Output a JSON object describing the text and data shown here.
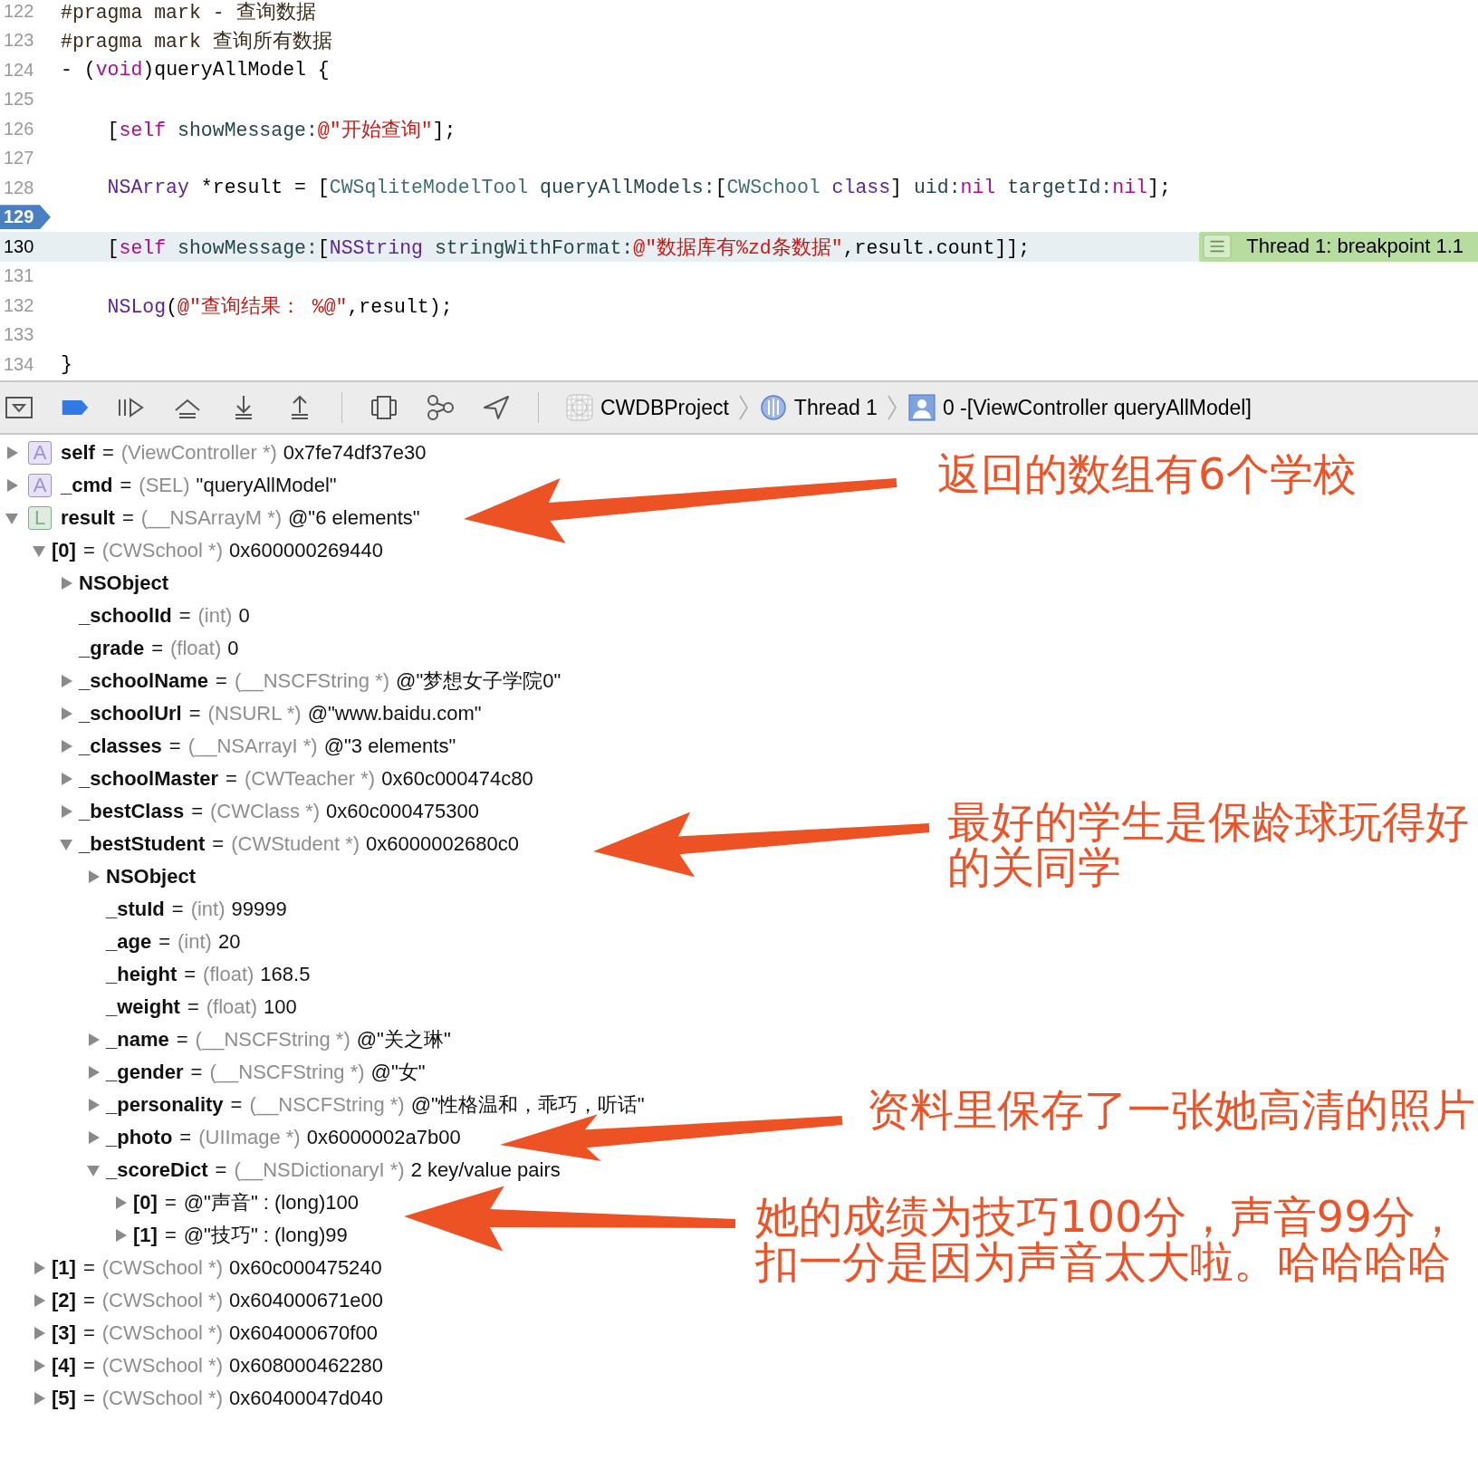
{
  "editor": {
    "lines": [
      {
        "number": "122",
        "breakpoint": false,
        "current": false,
        "tokens": [
          {
            "kind": "pre",
            "text": "#pragma mark - 查询数据"
          }
        ]
      },
      {
        "number": "123",
        "breakpoint": false,
        "current": false,
        "tokens": [
          {
            "kind": "pre",
            "text": "#pragma mark 查询所有数据"
          }
        ]
      },
      {
        "number": "124",
        "breakpoint": false,
        "current": false,
        "tokens": [
          {
            "kind": "plain",
            "text": "- ("
          },
          {
            "kind": "kw",
            "text": "void"
          },
          {
            "kind": "plain",
            "text": ")queryAllModel {"
          }
        ]
      },
      {
        "number": "125",
        "breakpoint": false,
        "current": false
      },
      {
        "number": "126",
        "breakpoint": false,
        "current": false,
        "tokens": [
          {
            "kind": "plain",
            "text": "    ["
          },
          {
            "kind": "kw",
            "text": "self "
          },
          {
            "kind": "meth",
            "text": "showMessage:"
          },
          {
            "kind": "str",
            "text": "@\"开始查询\""
          },
          {
            "kind": "plain",
            "text": "];"
          }
        ]
      },
      {
        "number": "127",
        "breakpoint": false,
        "current": false
      },
      {
        "number": "128",
        "breakpoint": false,
        "current": false,
        "tokens": [
          {
            "kind": "cls",
            "text": "    NSArray"
          },
          {
            "kind": "plain",
            "text": " *result = ["
          },
          {
            "kind": "proj",
            "text": "CWSqliteModelTool "
          },
          {
            "kind": "meth",
            "text": "queryAllModels:"
          },
          {
            "kind": "plain",
            "text": "["
          },
          {
            "kind": "proj",
            "text": "CWSchool "
          },
          {
            "kind": "cls",
            "text": "class"
          },
          {
            "kind": "plain",
            "text": "] "
          },
          {
            "kind": "meth",
            "text": "uid:"
          },
          {
            "kind": "kw",
            "text": "nil "
          },
          {
            "kind": "meth",
            "text": "targetId:"
          },
          {
            "kind": "kw",
            "text": "nil"
          },
          {
            "kind": "plain",
            "text": "];"
          }
        ]
      },
      {
        "number": "129",
        "breakpoint": true,
        "current": false
      },
      {
        "number": "130",
        "breakpoint": false,
        "current": true,
        "badge": "Thread 1: breakpoint 1.1",
        "tokens": [
          {
            "kind": "plain",
            "text": "    ["
          },
          {
            "kind": "kw",
            "text": "self "
          },
          {
            "kind": "meth",
            "text": "showMessage:"
          },
          {
            "kind": "plain",
            "text": "["
          },
          {
            "kind": "cls",
            "text": "NSString "
          },
          {
            "kind": "meth",
            "text": "stringWithFormat:"
          },
          {
            "kind": "str",
            "text": "@\"数据库有%zd条数据\""
          },
          {
            "kind": "plain",
            "text": ",result.count]];"
          }
        ]
      },
      {
        "number": "131",
        "breakpoint": false,
        "current": false
      },
      {
        "number": "132",
        "breakpoint": false,
        "current": false,
        "tokens": [
          {
            "kind": "cls",
            "text": "    NSLog"
          },
          {
            "kind": "plain",
            "text": "("
          },
          {
            "kind": "str",
            "text": "@\"查询结果： %@\""
          },
          {
            "kind": "plain",
            "text": ",result);"
          }
        ]
      },
      {
        "number": "133",
        "breakpoint": false,
        "current": false
      },
      {
        "number": "134",
        "breakpoint": false,
        "current": false,
        "tokens": [
          {
            "kind": "plain",
            "text": "}"
          }
        ]
      }
    ]
  },
  "debug_bar": {
    "breadcrumbs": [
      {
        "kind": "app",
        "text": "CWDBProject"
      },
      {
        "kind": "thread",
        "text": "Thread 1"
      },
      {
        "kind": "frame",
        "text": "0 -[ViewController queryAllModel]"
      }
    ]
  },
  "variables": [
    {
      "kind": "expandable",
      "expanded": false,
      "badge": "A",
      "color": "#9f8fd6",
      "name": "self",
      "op": "=",
      "type": "(ViewController *)",
      "value": "0x7fe74df37e30"
    },
    {
      "kind": "expandable",
      "expanded": false,
      "badge": "A",
      "color": "#9f8fd6",
      "name": "_cmd",
      "op": "=",
      "type": "(SEL)",
      "value": "\"queryAllModel\""
    },
    {
      "kind": "expandable",
      "expanded": true,
      "badge": "L",
      "color": "#7fae86",
      "name": "result",
      "op": "=",
      "type": "(__NSArrayM *)",
      "value": "@\"6 elements\"",
      "children": [
        {
          "kind": "expandable",
          "expanded": true,
          "name": "[0]",
          "op": "=",
          "type": "(CWSchool *)",
          "value": "0x600000269440",
          "children": [
            {
              "kind": "expandable",
              "expanded": false,
              "name": "NSObject"
            },
            {
              "kind": "leaf",
              "name": "_schoolId",
              "op": "=",
              "type": "(int)",
              "value": "0"
            },
            {
              "kind": "leaf",
              "name": "_grade",
              "op": "=",
              "type": "(float)",
              "value": "0"
            },
            {
              "kind": "expandable",
              "expanded": false,
              "name": "_schoolName",
              "op": "=",
              "type": "(__NSCFString *)",
              "value": "@\"梦想女子学院0\""
            },
            {
              "kind": "expandable",
              "expanded": false,
              "name": "_schoolUrl",
              "op": "=",
              "type": "(NSURL *)",
              "value": "@\"www.baidu.com\""
            },
            {
              "kind": "expandable",
              "expanded": false,
              "name": "_classes",
              "op": "=",
              "type": "(__NSArrayI *)",
              "value": "@\"3 elements\""
            },
            {
              "kind": "expandable",
              "expanded": false,
              "name": "_schoolMaster",
              "op": "=",
              "type": "(CWTeacher *)",
              "value": "0x60c000474c80"
            },
            {
              "kind": "expandable",
              "expanded": false,
              "name": "_bestClass",
              "op": "=",
              "type": "(CWClass *)",
              "value": "0x60c000475300"
            },
            {
              "kind": "expandable",
              "expanded": true,
              "name": "_bestStudent",
              "op": "=",
              "type": "(CWStudent *)",
              "value": "0x6000002680c0",
              "children": [
                {
                  "kind": "expandable",
                  "expanded": false,
                  "name": "NSObject"
                },
                {
                  "kind": "leaf",
                  "name": "_stuId",
                  "op": "=",
                  "type": "(int)",
                  "value": "99999"
                },
                {
                  "kind": "leaf",
                  "name": "_age",
                  "op": "=",
                  "type": "(int)",
                  "value": "20"
                },
                {
                  "kind": "leaf",
                  "name": "_height",
                  "op": "=",
                  "type": "(float)",
                  "value": "168.5"
                },
                {
                  "kind": "leaf",
                  "name": "_weight",
                  "op": "=",
                  "type": "(float)",
                  "value": "100"
                },
                {
                  "kind": "expandable",
                  "expanded": false,
                  "name": "_name",
                  "op": "=",
                  "type": "(__NSCFString *)",
                  "value": "@\"关之琳\""
                },
                {
                  "kind": "expandable",
                  "expanded": false,
                  "name": "_gender",
                  "op": "=",
                  "type": "(__NSCFString *)",
                  "value": "@\"女\""
                },
                {
                  "kind": "expandable",
                  "expanded": false,
                  "name": "_personality",
                  "op": "=",
                  "type": "(__NSCFString *)",
                  "value": "@\"性格温和，乖巧，听话\""
                },
                {
                  "kind": "expandable",
                  "expanded": false,
                  "name": "_photo",
                  "op": "=",
                  "type": "(UIImage *)",
                  "value": "0x6000002a7b00"
                },
                {
                  "kind": "expandable",
                  "expanded": true,
                  "name": "_scoreDict",
                  "op": "=",
                  "type": "(__NSDictionaryI *)",
                  "value": "2 key/value pairs",
                  "children": [
                    {
                      "kind": "expandable",
                      "expanded": false,
                      "name": "[0]",
                      "op": "=",
                      "value": "@\"声音\" : (long)100"
                    },
                    {
                      "kind": "expandable",
                      "expanded": false,
                      "name": "[1]",
                      "op": "=",
                      "value": "@\"技巧\" : (long)99"
                    }
                  ]
                }
              ]
            }
          ]
        },
        {
          "kind": "expandable",
          "expanded": false,
          "name": "[1]",
          "op": "=",
          "type": "(CWSchool *)",
          "value": "0x60c000475240"
        },
        {
          "kind": "expandable",
          "expanded": false,
          "name": "[2]",
          "op": "=",
          "type": "(CWSchool *)",
          "value": "0x604000671e00"
        },
        {
          "kind": "expandable",
          "expanded": false,
          "name": "[3]",
          "op": "=",
          "type": "(CWSchool *)",
          "value": "0x604000670f00"
        },
        {
          "kind": "expandable",
          "expanded": false,
          "name": "[4]",
          "op": "=",
          "type": "(CWSchool *)",
          "value": "0x608000462280"
        },
        {
          "kind": "expandable",
          "expanded": false,
          "name": "[5]",
          "op": "=",
          "type": "(CWSchool *)",
          "value": "0x60400047d040"
        }
      ]
    }
  ],
  "annotations": [
    {
      "lines": [
        "返回的数组有6个学校"
      ]
    },
    {
      "lines": [
        "最好的学生是保龄球玩得好",
        "的关同学"
      ]
    },
    {
      "lines": [
        "资料里保存了一张她高清的照片"
      ]
    },
    {
      "lines": [
        "她的成绩为技巧100分，声音99分，",
        "扣一分是因为声音太大啦。哈哈哈哈"
      ]
    }
  ]
}
